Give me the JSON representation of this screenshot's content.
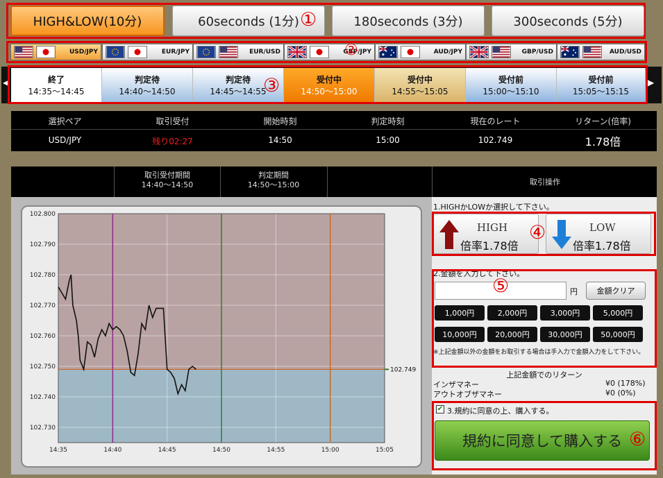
{
  "tabs": [
    {
      "label": "HIGH&LOW(10分)",
      "active": true
    },
    {
      "label": "60seconds (1分)"
    },
    {
      "label": "180seconds (3分)"
    },
    {
      "label": "300seconds (5分)"
    }
  ],
  "pairs": [
    "USD/JPY",
    "EUR/JPY",
    "EUR/USD",
    "GBP/JPY",
    "AUD/JPY",
    "GBP/USD",
    "AUD/USD"
  ],
  "slots": [
    {
      "status": "終了",
      "time": "14:35～14:45"
    },
    {
      "status": "判定待",
      "time": "14:40～14:50"
    },
    {
      "status": "判定待",
      "time": "14:45～14:55"
    },
    {
      "status": "受付中",
      "time": "14:50～15:00"
    },
    {
      "status": "受付中",
      "time": "14:55～15:05"
    },
    {
      "status": "受付前",
      "time": "15:00～15:10"
    },
    {
      "status": "受付前",
      "time": "15:05～15:15"
    }
  ],
  "info": {
    "headers": [
      "選択ペア",
      "取引受付",
      "開始時刻",
      "判定時刻",
      "現在のレート",
      "リターン(倍率)"
    ],
    "values": [
      "USD/JPY",
      "残り02:27",
      "14:50",
      "15:00",
      "102.749",
      "1.78倍"
    ]
  },
  "panel": {
    "period1_label": "取引受付期間",
    "period1_time": "14:40～14:50",
    "period2_label": "判定期間",
    "period2_time": "14:50～15:00",
    "ops_label": "取引操作"
  },
  "controls": {
    "step1": "1.HIGHかLOWか選択して下さい。",
    "high_label": "HIGH",
    "high_rate": "倍率1.78倍",
    "low_label": "LOW",
    "low_rate": "倍率1.78倍",
    "step2": "2.金額を入力して下さい。",
    "amount_value": "",
    "yen": "円",
    "clear_label": "金額クリア",
    "amounts": [
      "1,000円",
      "2,000円",
      "3,000円",
      "5,000円",
      "10,000円",
      "20,000円",
      "30,000円",
      "50,000円"
    ],
    "note": "※上記金額以外の金額をお取引する場合は手入力で金額入力をして下さい。",
    "return_title": "上記金額でのリターン",
    "in_label": "インザマネー",
    "in_value": "¥0 (178%)",
    "out_label": "アウトオブザマネー",
    "out_value": "¥0 (0%)",
    "agree_label": "3.規約に同意の上、購入する。",
    "agree_checked": true,
    "buy_label": "規約に同意して購入する"
  },
  "annotations": [
    "①",
    "②",
    "③",
    "④",
    "⑤",
    "⑥"
  ],
  "chart_data": {
    "type": "line",
    "x": [
      "14:35:00",
      "14:35:20",
      "14:35:40",
      "14:36:00",
      "14:36:10",
      "14:36:20",
      "14:36:40",
      "14:36:50",
      "14:37:00",
      "14:37:20",
      "14:37:40",
      "14:38:00",
      "14:38:20",
      "14:38:40",
      "14:39:00",
      "14:39:20",
      "14:39:40",
      "14:40:00",
      "14:40:20",
      "14:40:40",
      "14:41:00",
      "14:41:20",
      "14:41:40",
      "14:42:00",
      "14:42:20",
      "14:42:40",
      "14:43:00",
      "14:43:20",
      "14:43:40",
      "14:44:00",
      "14:44:20",
      "14:44:40",
      "14:45:00",
      "14:45:20",
      "14:45:40",
      "14:46:00",
      "14:46:20",
      "14:46:40",
      "14:47:00",
      "14:47:20",
      "14:47:40"
    ],
    "y": [
      102.776,
      102.774,
      102.772,
      102.778,
      102.78,
      102.77,
      102.765,
      102.76,
      102.752,
      102.749,
      102.758,
      102.757,
      102.753,
      102.759,
      102.762,
      102.76,
      102.764,
      102.762,
      102.763,
      102.762,
      102.76,
      102.755,
      102.748,
      102.747,
      102.754,
      102.764,
      102.762,
      102.77,
      102.766,
      102.769,
      102.769,
      102.769,
      102.749,
      102.748,
      102.746,
      102.741,
      102.744,
      102.742,
      102.749,
      102.75,
      102.749
    ],
    "current_rate": 102.749,
    "xticks": [
      "14:35",
      "14:40",
      "14:45",
      "14:50",
      "14:55",
      "15:00",
      "15:05"
    ],
    "yticks": [
      "102.800",
      "102.790",
      "102.780",
      "102.770",
      "102.760",
      "102.750",
      "102.740",
      "102.730"
    ],
    "ylim": [
      102.725,
      102.8
    ],
    "xlim": [
      "14:35",
      "15:05"
    ],
    "vlines": [
      {
        "x": "14:40",
        "color": "#8e2a8a"
      },
      {
        "x": "14:50",
        "color": "#2e7d2e"
      },
      {
        "x": "15:00",
        "color": "#c86a1e"
      }
    ],
    "colors": {
      "above": "#b9a2a2",
      "below": "#9fb8c6"
    }
  }
}
